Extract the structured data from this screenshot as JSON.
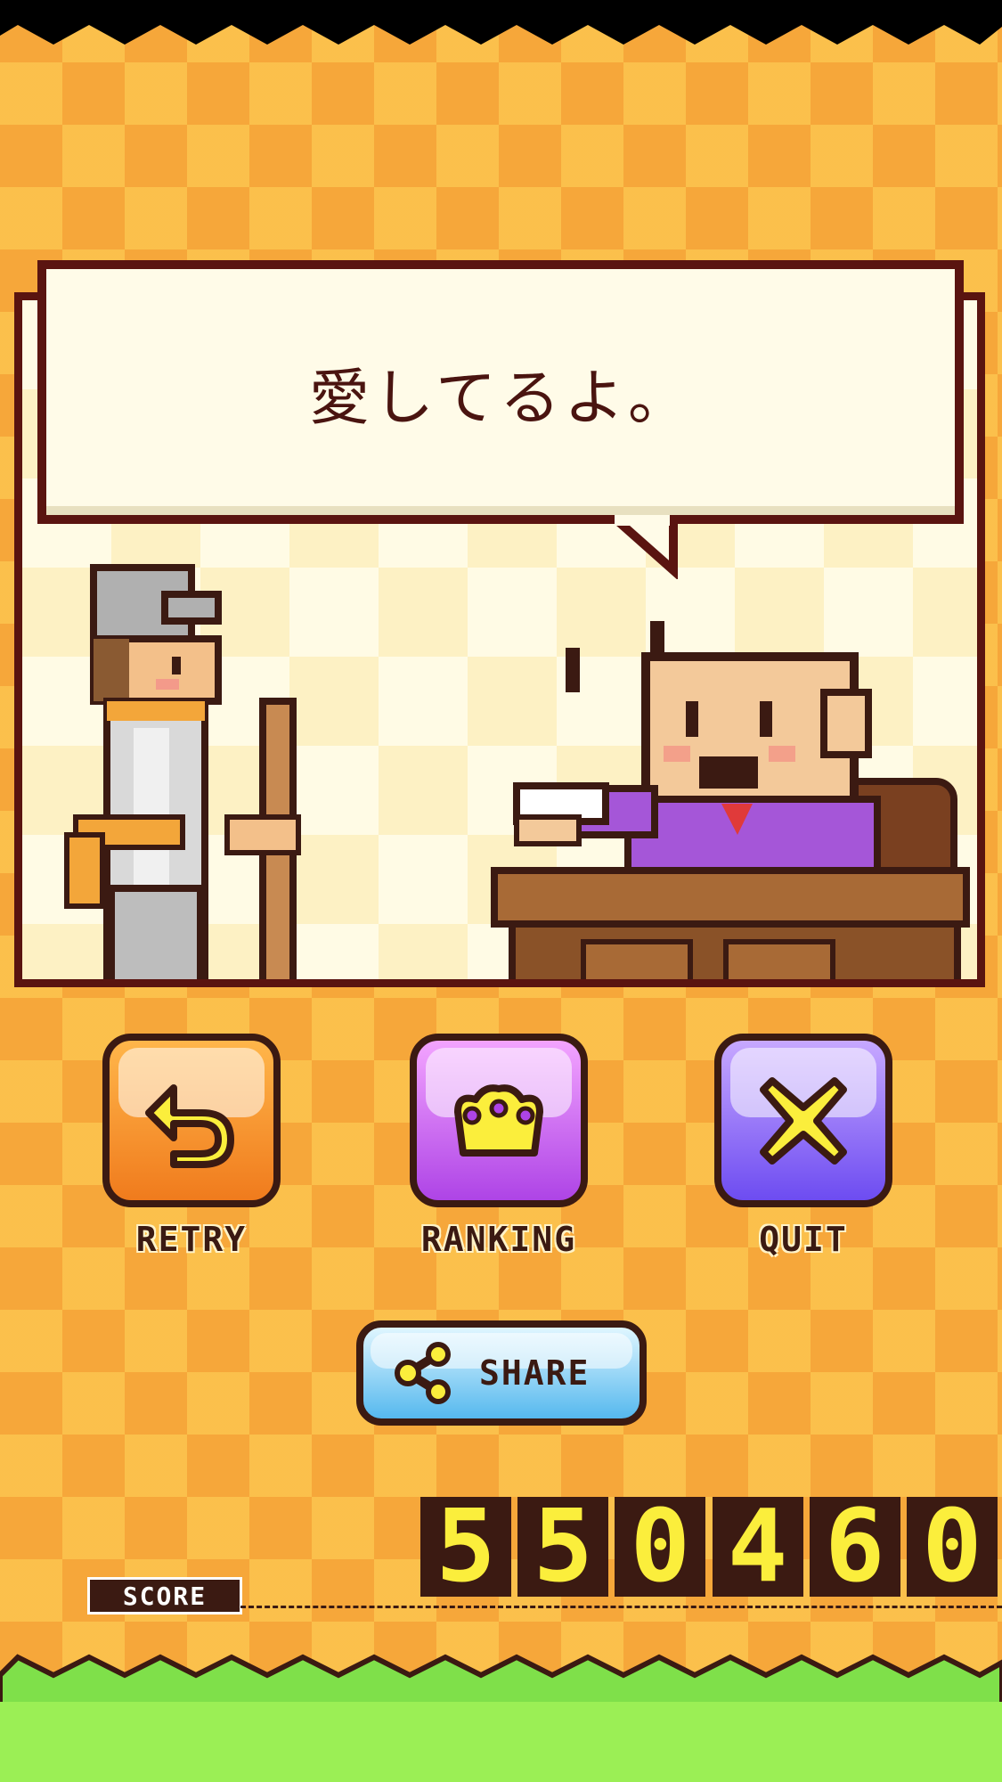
{
  "dialog": {
    "message": "愛してるよ。"
  },
  "buttons": {
    "retry": {
      "label": "RETRY",
      "icon": "retry-arrow-icon"
    },
    "ranking": {
      "label": "RANKING",
      "icon": "crown-icon"
    },
    "quit": {
      "label": "QUIT",
      "icon": "close-icon"
    },
    "share": {
      "label": "SHARE",
      "icon": "share-icon"
    }
  },
  "score": {
    "label": "SCORE",
    "digits": [
      "5",
      "5",
      "0",
      "4",
      "6",
      "0"
    ]
  },
  "colors": {
    "retry": "#f07b1d",
    "ranking": "#ae44e6",
    "quit": "#6d4cf1",
    "share": "#55b8ee",
    "score_digit": "#fbee3c",
    "outline": "#3b1a12"
  }
}
